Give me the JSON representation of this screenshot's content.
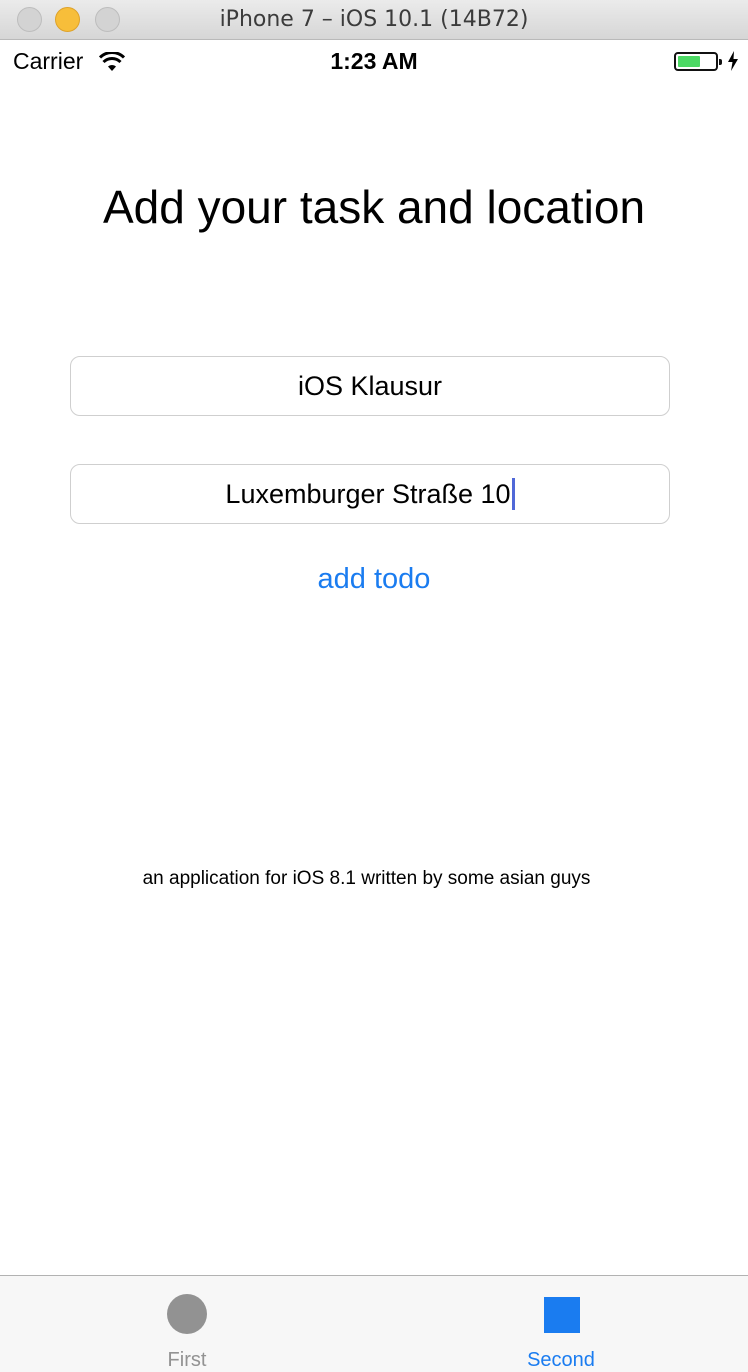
{
  "window": {
    "title": "iPhone 7 – iOS 10.1 (14B72)"
  },
  "status_bar": {
    "carrier": "Carrier",
    "time": "1:23 AM",
    "battery_level": 0.6
  },
  "main": {
    "heading": "Add your task and location",
    "task_field": {
      "value": "iOS Klausur"
    },
    "location_field": {
      "value": "Luxemburger Straße 10"
    },
    "add_button_label": "add todo",
    "footer_note": "an application for iOS 8.1 written by some asian guys"
  },
  "tab_bar": {
    "tabs": [
      {
        "label": "First",
        "icon": "circle-icon",
        "selected": false
      },
      {
        "label": "Second",
        "icon": "square-icon",
        "selected": true
      }
    ],
    "accent_color": "#1a7cf0",
    "inactive_color": "#929292"
  }
}
